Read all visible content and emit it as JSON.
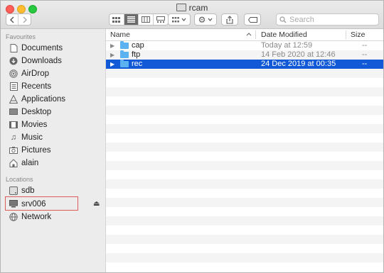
{
  "window": {
    "title": "rcam",
    "search_placeholder": "Search"
  },
  "sidebar": {
    "favourites_heading": "Favourites",
    "favourites": [
      {
        "label": "Documents",
        "icon": "documents-icon"
      },
      {
        "label": "Downloads",
        "icon": "downloads-icon"
      },
      {
        "label": "AirDrop",
        "icon": "airdrop-icon"
      },
      {
        "label": "Recents",
        "icon": "recents-icon"
      },
      {
        "label": "Applications",
        "icon": "applications-icon"
      },
      {
        "label": "Desktop",
        "icon": "desktop-icon"
      },
      {
        "label": "Movies",
        "icon": "movies-icon"
      },
      {
        "label": "Music",
        "icon": "music-icon"
      },
      {
        "label": "Pictures",
        "icon": "pictures-icon"
      },
      {
        "label": "alain",
        "icon": "home-icon"
      }
    ],
    "locations_heading": "Locations",
    "locations": [
      {
        "label": "sdb",
        "icon": "disk-icon"
      },
      {
        "label": "srv006",
        "icon": "server-icon"
      },
      {
        "label": "Network",
        "icon": "network-icon"
      }
    ]
  },
  "columns": {
    "name": "Name",
    "date_modified": "Date Modified",
    "size": "Size"
  },
  "files": [
    {
      "name": "cap",
      "date": "Today at 12:59",
      "size": "--",
      "selected": false
    },
    {
      "name": "ftp",
      "date": "14 Feb 2020 at 12:46",
      "size": "--",
      "selected": false
    },
    {
      "name": "rec",
      "date": "24 Dec 2019 at 00:35",
      "size": "--",
      "selected": true
    }
  ],
  "colors": {
    "selection": "#1159d6",
    "highlight_box": "#e05a5a",
    "folder": "#5ab3f0"
  }
}
